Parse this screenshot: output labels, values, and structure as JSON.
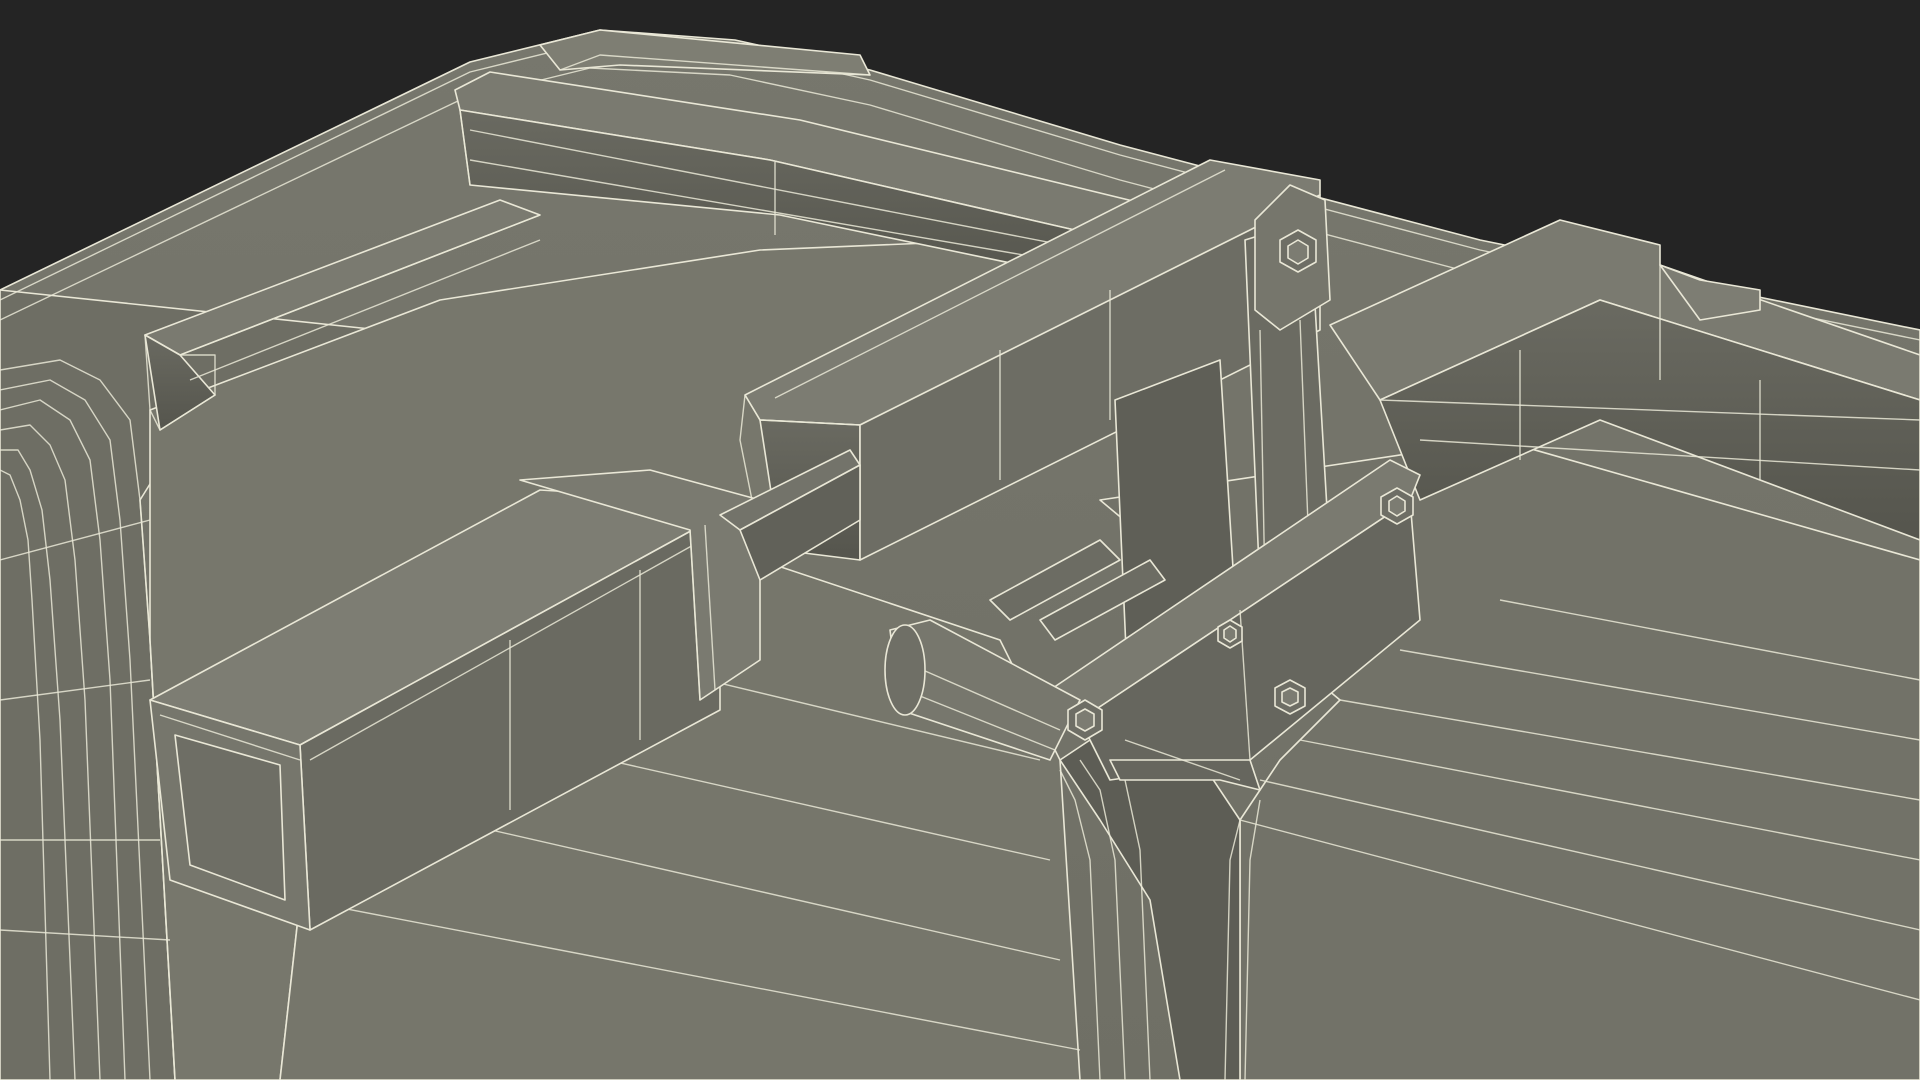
{
  "scene": {
    "kind": "3d-wireframe-render",
    "subject": "case-lid-with-bars-and-latch",
    "colors": {
      "background": "#242424",
      "surface_top": "#7b7b70",
      "surface_mid": "#717167",
      "surface_dark": "#5f5f56",
      "surface_shadow": "#4e4e46",
      "wire": "#e9e7d6"
    }
  }
}
